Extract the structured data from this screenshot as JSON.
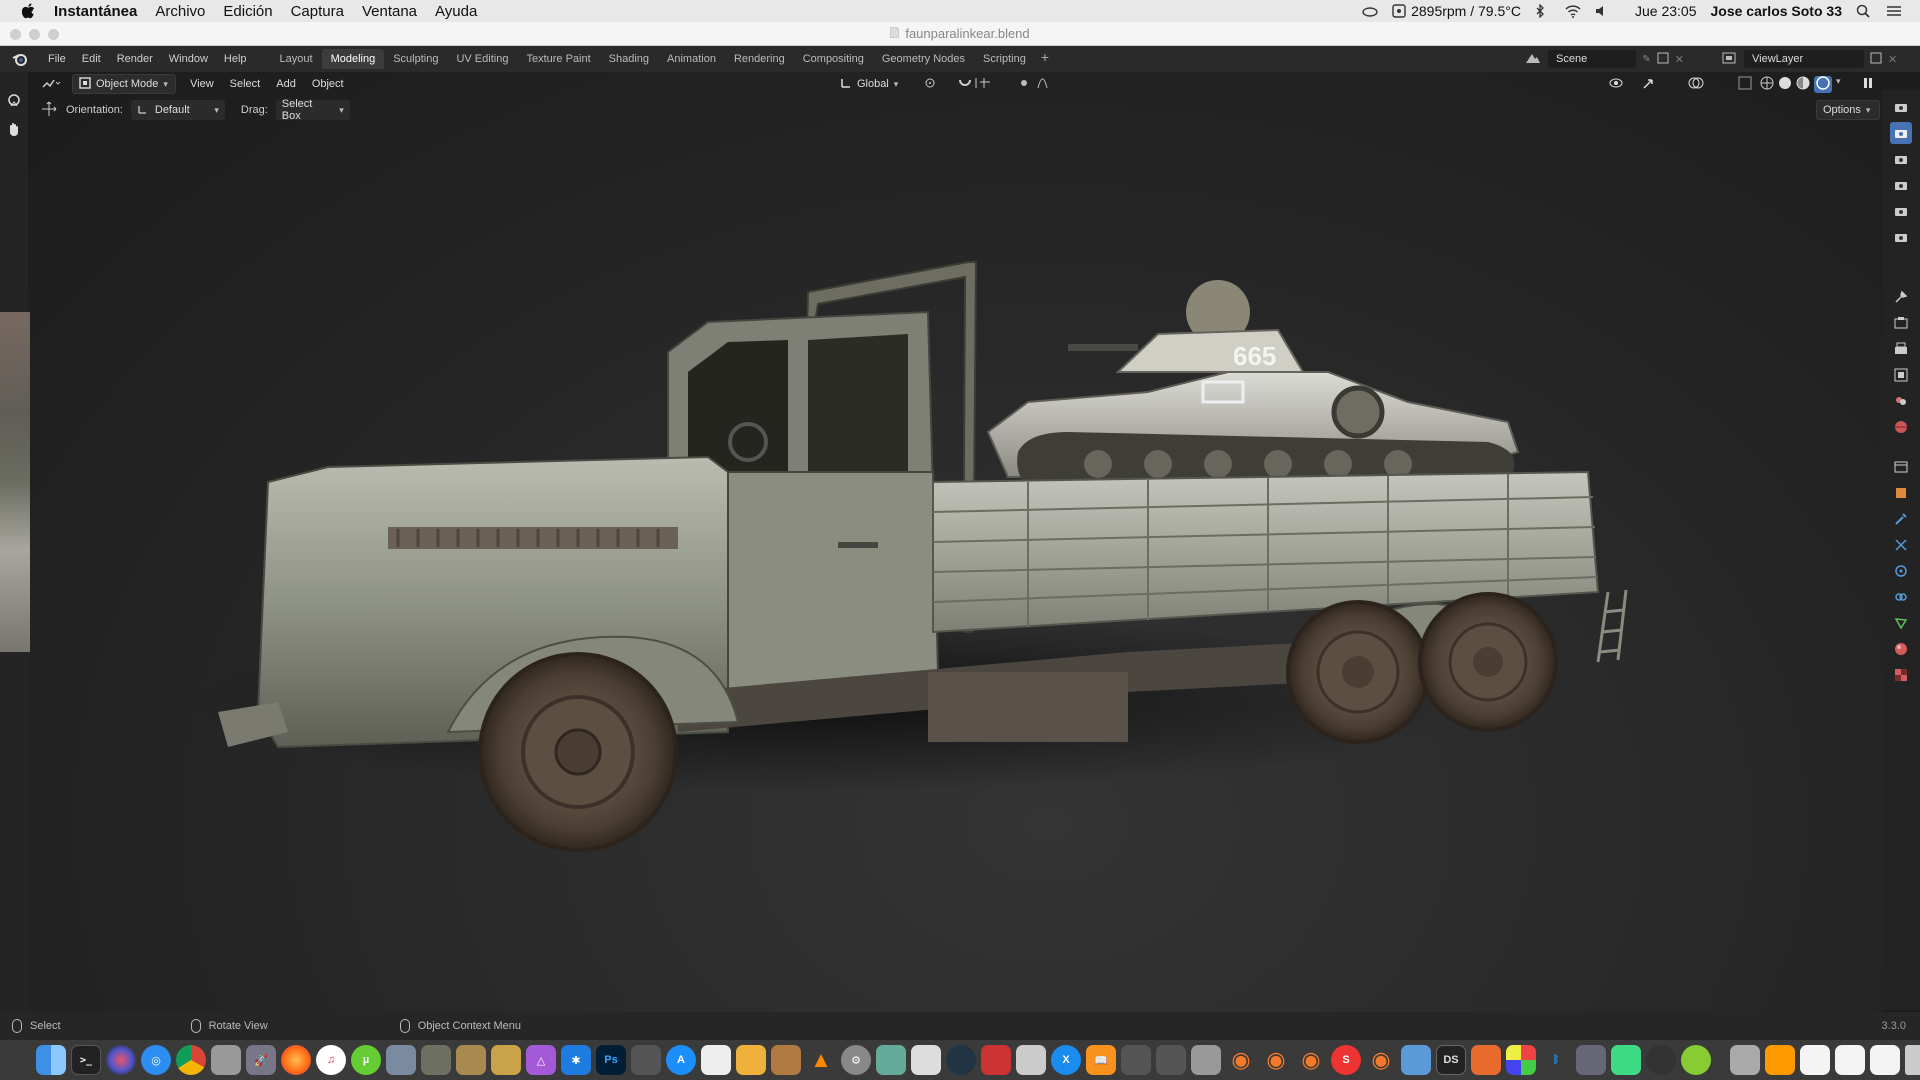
{
  "macos_menubar": {
    "app_name": "Instantánea",
    "menus": [
      "Archivo",
      "Edición",
      "Captura",
      "Ventana",
      "Ayuda"
    ],
    "fan_status": "2895rpm / 79.5°C",
    "clock": "Jue 23:05",
    "user": "Jose carlos Soto 33"
  },
  "window": {
    "title": "faunparalinkear.blend"
  },
  "blender_topbar": {
    "menus": [
      "File",
      "Edit",
      "Render",
      "Window",
      "Help"
    ],
    "workspace_tabs": [
      "Layout",
      "Modeling",
      "Sculpting",
      "UV Editing",
      "Texture Paint",
      "Shading",
      "Animation",
      "Rendering",
      "Compositing",
      "Geometry Nodes",
      "Scripting"
    ],
    "active_tab": "Modeling",
    "scene_name": "Scene",
    "view_layer": "ViewLayer"
  },
  "viewport_header": {
    "mode": "Object Mode",
    "menus": [
      "View",
      "Select",
      "Add",
      "Object"
    ],
    "transform_orientation": "Global"
  },
  "tool_options": {
    "orientation_label": "Orientation:",
    "orientation_value": "Default",
    "drag_label": "Drag:",
    "drag_value": "Select Box",
    "options_label": "Options"
  },
  "statusbar": {
    "select": "Select",
    "rotate_view": "Rotate View",
    "context_menu": "Object Context Menu",
    "version": "3.3.0"
  },
  "colors": {
    "accent_blue": "#4772b3",
    "active_tab_bg": "#3c3c3c",
    "viewport_bg": "#2b2b2b"
  },
  "icons": {
    "left_tools": [
      "select-icon",
      "cursor-icon",
      "move-icon"
    ],
    "right_properties": [
      "tool-icon",
      "render-icon",
      "output-icon",
      "view-layer-icon",
      "scene-icon",
      "world-icon",
      "collection-icon",
      "object-icon",
      "modifier-icon",
      "particles-icon",
      "physics-icon",
      "constraints-icon",
      "data-icon",
      "material-icon",
      "texture-icon"
    ]
  }
}
